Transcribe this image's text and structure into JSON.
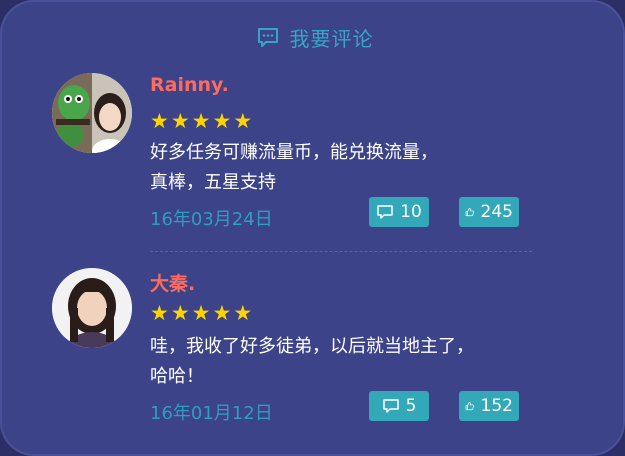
{
  "header": {
    "title": "我要评论",
    "icon": "comment-icon"
  },
  "comments": [
    {
      "username": "Rainny.",
      "stars": [
        "★",
        "★",
        "★",
        "★",
        "★"
      ],
      "text_lines": [
        "好多任务可赚流量币，能兑换流量，",
        "真棒，五星支持"
      ],
      "date": "16年03月24日",
      "reply_count": "10",
      "like_count": "245"
    },
    {
      "username": "大秦.",
      "stars": [
        "★",
        "★",
        "★",
        "★",
        "★"
      ],
      "text_lines": [
        "哇，我收了好多徒弟，以后就当地主了，",
        "哈哈！"
      ],
      "date": "16年01月12日",
      "reply_count": "5",
      "like_count": "152"
    }
  ],
  "colors": {
    "background": "#3c4388",
    "accent": "#37a6c4",
    "username": "#ff6b5e",
    "star": "#ffd400",
    "badge": "#33a8b8"
  }
}
